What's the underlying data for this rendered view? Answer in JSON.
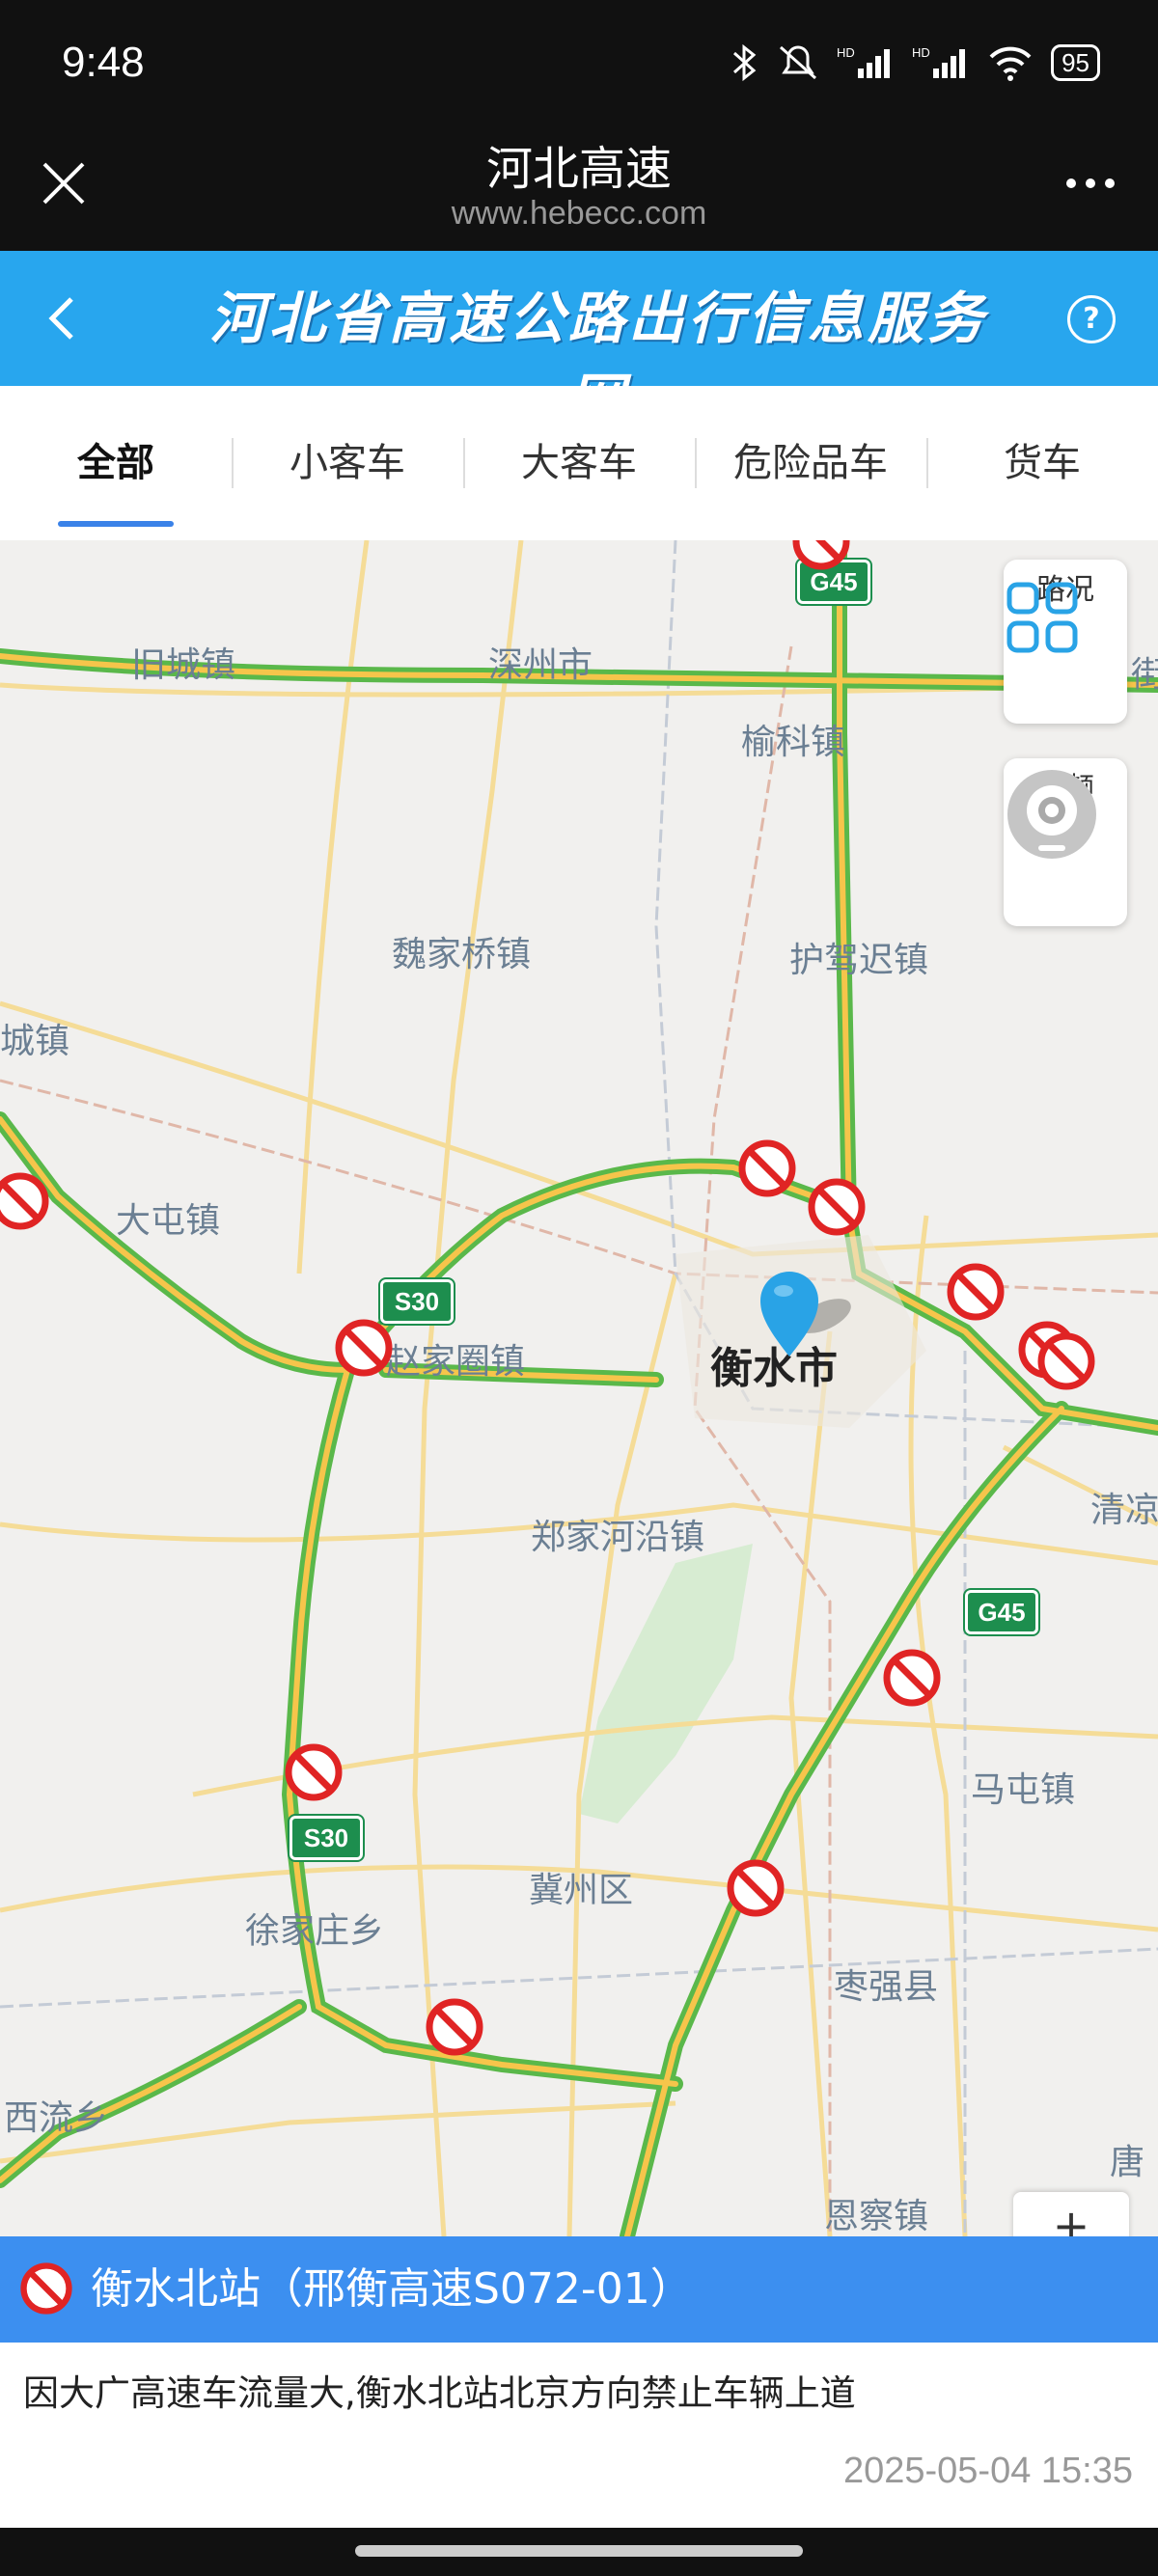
{
  "status": {
    "time": "9:48",
    "battery": "95"
  },
  "browser": {
    "title": "河北高速",
    "url": "www.hebecc.com"
  },
  "site": {
    "brand": "河北省高速公路出行信息服务网"
  },
  "tabs": [
    "全部",
    "小客车",
    "大客车",
    "危险品车",
    "货车"
  ],
  "map": {
    "controls": {
      "traffic": "路况",
      "video": "视频"
    },
    "places": {
      "jiuchengzhen": "旧城镇",
      "shenzhoushi": "深州市",
      "yukezhen": "榆科镇",
      "wei": "街",
      "weijiaqiaozhen": "魏家桥镇",
      "hujiachizhen": "护驾迟镇",
      "chengzhen": "城镇",
      "datunzhen": "大屯镇",
      "zhaojiaquanzhen": "赵家圈镇",
      "hengshui": "衡水市",
      "qingliang": "清凉",
      "zhengjiaheyanzhen": "郑家河沿镇",
      "matunzhen": "马屯镇",
      "jizhouqu": "冀州区",
      "xujiazhuangxiang": "徐家庄乡",
      "zaoqiangxian": "枣强县",
      "xiliuxiang": "西流乡",
      "enchazhen": "恩察镇",
      "tang": "唐"
    },
    "shields": {
      "g45_top": "G45",
      "s30_left": "S30",
      "g45_right": "G45",
      "s30_bottom": "S30"
    },
    "zoom_in": "+"
  },
  "info": {
    "station": "衡水北站（邢衡高速S072-01）",
    "description": "因大广高速车流量大,衡水北站北京方向禁止车辆上道",
    "timestamp": "2025-05-04 15:35"
  }
}
